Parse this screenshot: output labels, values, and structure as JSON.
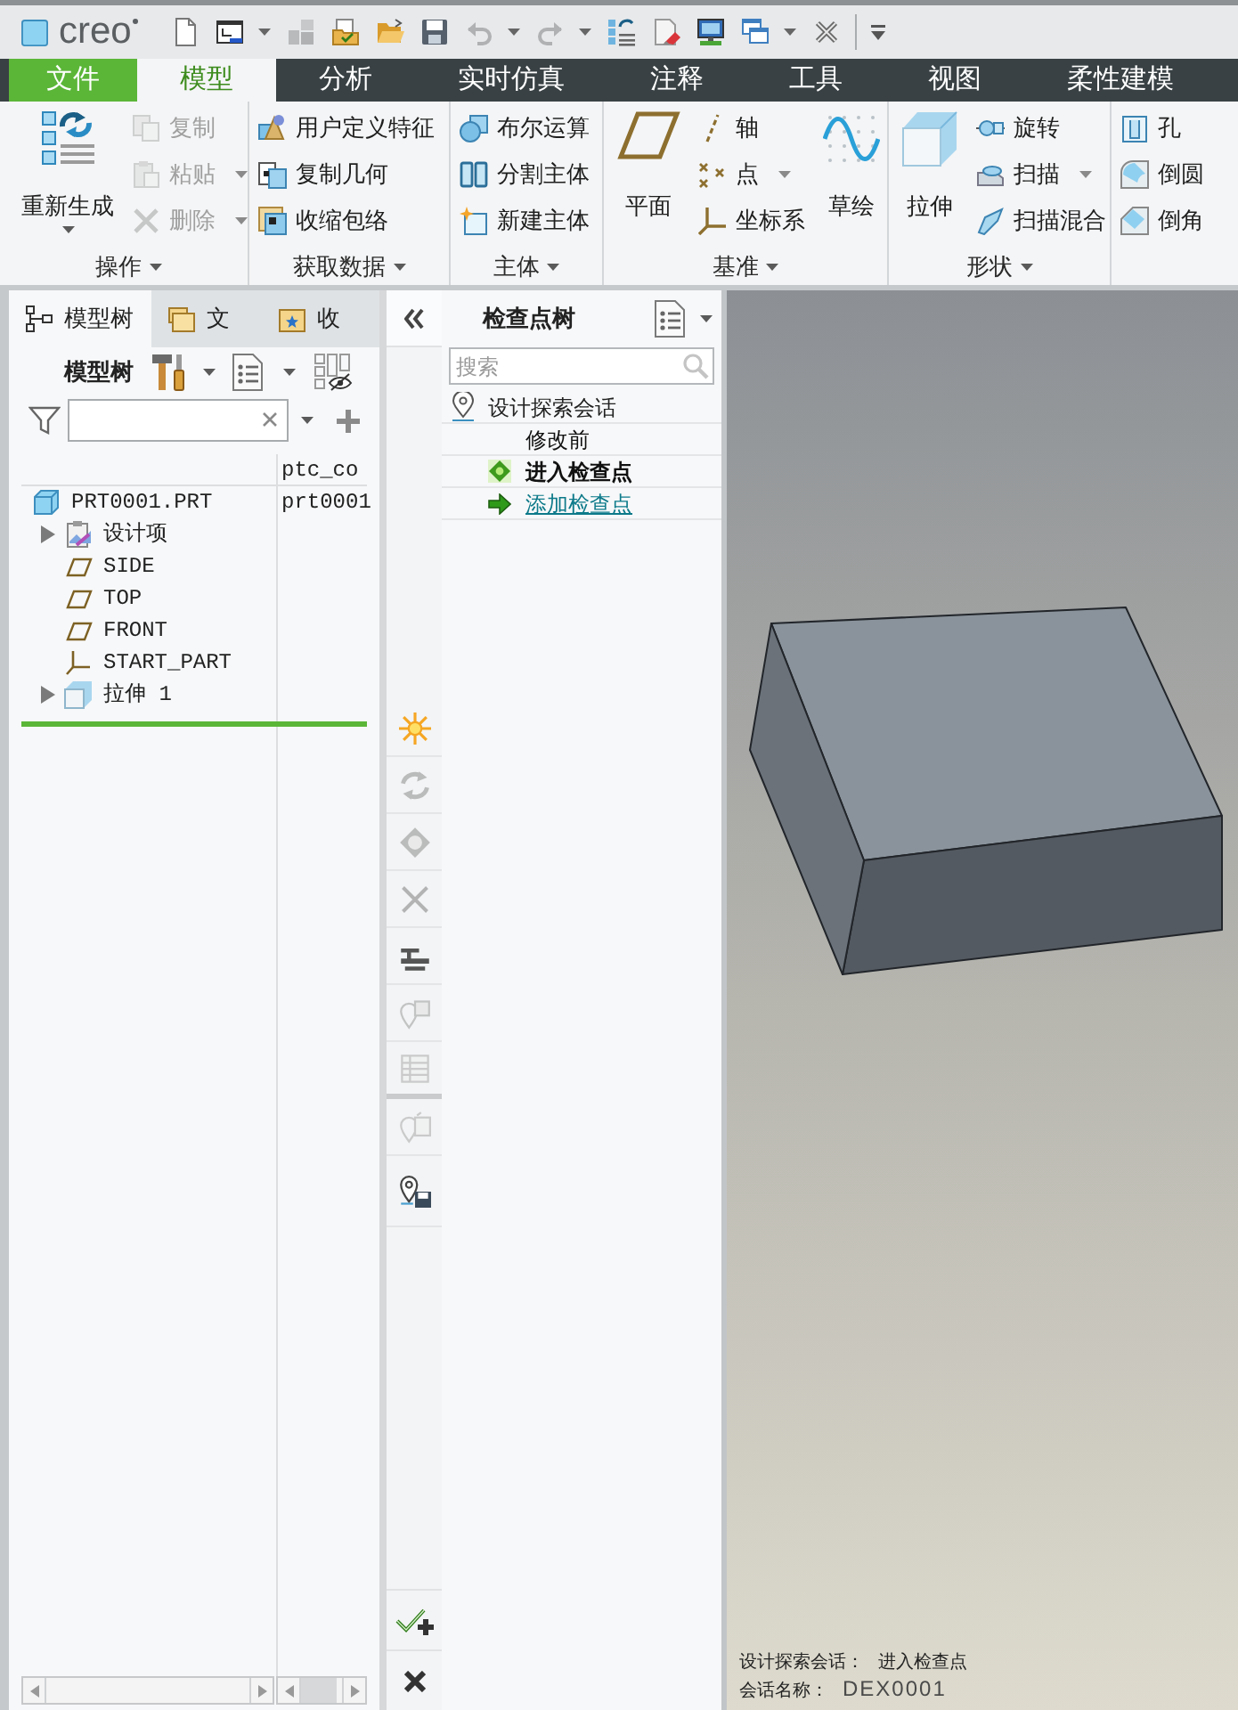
{
  "app": {
    "logo": "creo"
  },
  "quick_access_tools": [
    {
      "disabled": false,
      "dropdown": false
    },
    {
      "disabled": false,
      "dropdown": true
    },
    {
      "disabled": true,
      "dropdown": false
    },
    {
      "disabled": false,
      "dropdown": false
    },
    {
      "disabled": false,
      "dropdown": false
    },
    {
      "disabled": false,
      "dropdown": false
    },
    {
      "disabled": true,
      "dropdown": true
    },
    {
      "disabled": true,
      "dropdown": true
    },
    {
      "disabled": false,
      "dropdown": false
    },
    {
      "disabled": false,
      "dropdown": false
    },
    {
      "disabled": false,
      "dropdown": false
    },
    {
      "disabled": false,
      "dropdown": true
    },
    {
      "disabled": false,
      "dropdown": false
    }
  ],
  "ribbon_tabs": [
    {
      "label": "文件",
      "kind": "file",
      "selected": false
    },
    {
      "label": "模型",
      "kind": "tab",
      "selected": true
    },
    {
      "label": "分析",
      "kind": "tab",
      "selected": false
    },
    {
      "label": "实时仿真",
      "kind": "tab",
      "selected": false
    },
    {
      "label": "注释",
      "kind": "tab",
      "selected": false
    },
    {
      "label": "工具",
      "kind": "tab",
      "selected": false
    },
    {
      "label": "视图",
      "kind": "tab",
      "selected": false
    },
    {
      "label": "柔性建模",
      "kind": "tab",
      "selected": false
    }
  ],
  "ribbon_groups": [
    {
      "label": "操作",
      "items": [
        {
          "label": "重新生成",
          "kind": "large",
          "disabled": false,
          "dropdown": true
        },
        {
          "label": "复制",
          "kind": "small",
          "disabled": true,
          "dropdown": false
        },
        {
          "label": "粘贴",
          "kind": "small",
          "disabled": true,
          "dropdown": true
        },
        {
          "label": "删除",
          "kind": "small",
          "disabled": true,
          "dropdown": true
        }
      ]
    },
    {
      "label": "获取数据",
      "items": [
        {
          "label": "用户定义特征",
          "kind": "small",
          "disabled": false,
          "dropdown": false
        },
        {
          "label": "复制几何",
          "kind": "small",
          "disabled": false,
          "dropdown": false
        },
        {
          "label": "收缩包络",
          "kind": "small",
          "disabled": false,
          "dropdown": false
        }
      ]
    },
    {
      "label": "主体",
      "items": [
        {
          "label": "布尔运算",
          "kind": "small",
          "disabled": false,
          "dropdown": false
        },
        {
          "label": "分割主体",
          "kind": "small",
          "disabled": false,
          "dropdown": false
        },
        {
          "label": "新建主体",
          "kind": "small",
          "disabled": false,
          "dropdown": false
        }
      ]
    },
    {
      "label": "基准",
      "items": [
        {
          "label": "平面",
          "kind": "large",
          "disabled": false,
          "dropdown": false
        },
        {
          "label": "轴",
          "kind": "small",
          "disabled": false,
          "dropdown": false
        },
        {
          "label": "点",
          "kind": "small",
          "disabled": false,
          "dropdown": true
        },
        {
          "label": "坐标系",
          "kind": "small",
          "disabled": false,
          "dropdown": false
        },
        {
          "label": "草绘",
          "kind": "large",
          "disabled": false,
          "dropdown": false
        }
      ]
    },
    {
      "label": "形状",
      "items": [
        {
          "label": "拉伸",
          "kind": "large",
          "disabled": false,
          "dropdown": false
        },
        {
          "label": "旋转",
          "kind": "small",
          "disabled": false,
          "dropdown": false
        },
        {
          "label": "扫描",
          "kind": "small",
          "disabled": false,
          "dropdown": true
        },
        {
          "label": "扫描混合",
          "kind": "small",
          "disabled": false,
          "dropdown": false
        }
      ]
    },
    {
      "items": [
        {
          "label": "孔",
          "kind": "small",
          "disabled": false,
          "dropdown": false
        },
        {
          "label": "倒圆",
          "kind": "small",
          "disabled": false,
          "dropdown": false
        },
        {
          "label": "倒角",
          "kind": "small",
          "disabled": false,
          "dropdown": false
        }
      ]
    }
  ],
  "model_tree_panel": {
    "tabs": [
      {
        "label": "模型树",
        "selected": true
      },
      {
        "label": "文",
        "selected": false
      },
      {
        "label": "收",
        "selected": false
      }
    ],
    "title": "模型树",
    "column_2_header": "ptc_co",
    "items": [
      {
        "label": "PRT0001.PRT",
        "kind": "part",
        "column_2": "prt0001",
        "children": [
          {
            "label": "设计项",
            "kind": "folder",
            "expanded": false
          },
          {
            "label": "SIDE",
            "kind": "plane"
          },
          {
            "label": "TOP",
            "kind": "plane"
          },
          {
            "label": "FRONT",
            "kind": "plane"
          },
          {
            "label": "START_PART",
            "kind": "csys"
          },
          {
            "label": "拉伸 1",
            "kind": "extrude",
            "expanded": false
          }
        ]
      }
    ]
  },
  "checkpoint_tools": [
    {
      "disabled": false
    },
    {
      "disabled": true
    },
    {
      "disabled": true
    },
    {
      "disabled": true
    },
    {
      "disabled": false
    },
    {
      "disabled": true
    },
    {
      "disabled": true
    },
    {
      "disabled": true
    },
    {
      "disabled": false
    }
  ],
  "checkpoint_tree": {
    "title": "检查点树",
    "search_placeholder": "搜索",
    "items": [
      {
        "label": "设计探索会话",
        "kind": "session",
        "children": [
          {
            "label": "修改前",
            "kind": "checkpoint",
            "current": false
          },
          {
            "label": "进入检查点",
            "kind": "checkpoint",
            "current": true
          },
          {
            "label": "添加检查点",
            "kind": "link"
          }
        ]
      }
    ]
  },
  "viewport": {
    "info": [
      {
        "label": "设计探索会话：",
        "value": "进入检查点"
      },
      {
        "label": "会话名称：",
        "value": "DEX0001"
      }
    ]
  }
}
